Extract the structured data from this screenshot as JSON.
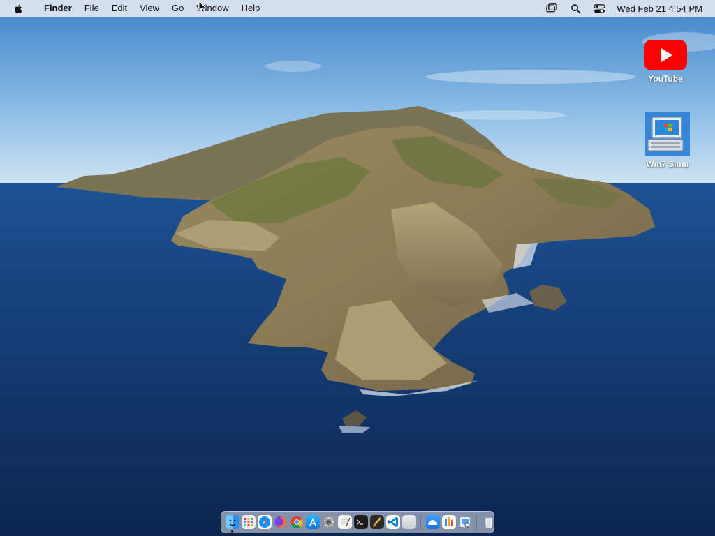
{
  "menubar": {
    "app_name": "Finder",
    "menus": [
      "File",
      "Edit",
      "View",
      "Go",
      "Window",
      "Help"
    ],
    "clock": "Wed Feb 21  4:54 PM"
  },
  "desktop": {
    "icons": [
      {
        "label": "YouTube",
        "icon": "youtube-icon"
      },
      {
        "label": "Win7 Simu",
        "icon": "win7-simulator-icon"
      }
    ]
  },
  "dock": {
    "apps": [
      {
        "icon": "finder-icon",
        "running": true
      },
      {
        "icon": "launchpad-icon"
      },
      {
        "icon": "safari-icon"
      },
      {
        "icon": "firefox-icon"
      },
      {
        "icon": "chrome-icon"
      },
      {
        "icon": "app-store-icon"
      },
      {
        "icon": "system-preferences-icon"
      },
      {
        "icon": "textedit-icon"
      },
      {
        "icon": "terminal-icon"
      },
      {
        "icon": "brush-app-icon"
      },
      {
        "icon": "vscode-icon"
      },
      {
        "icon": "generic-app-icon"
      },
      {
        "icon": "weather-icon"
      },
      {
        "icon": "bars-app-icon"
      },
      {
        "icon": "preview-icon"
      },
      {
        "icon": "trash-icon"
      }
    ]
  },
  "colors": {
    "menubar_bg": "#eceef3",
    "sky_top": "#3f82c8",
    "sea_deep": "#0e2d5e",
    "youtube_red": "#ff0000"
  }
}
